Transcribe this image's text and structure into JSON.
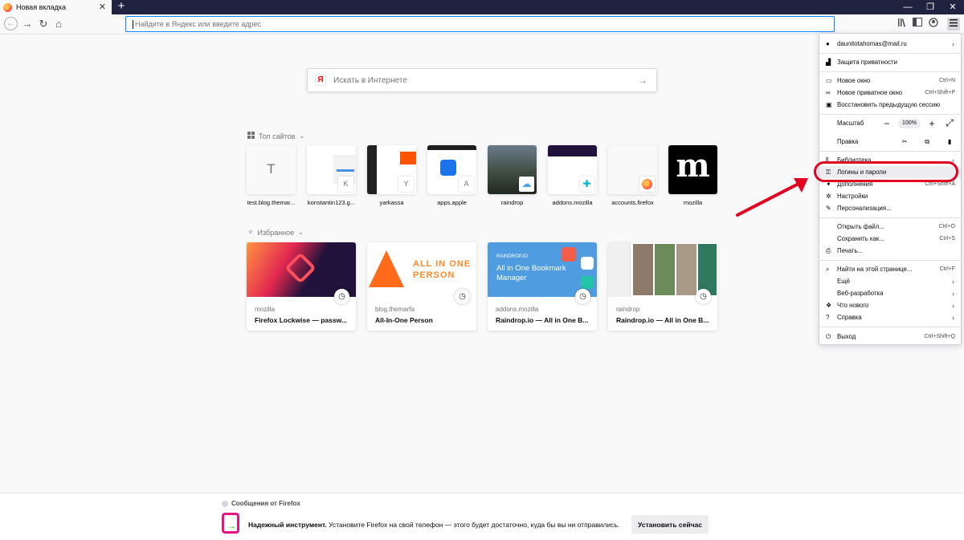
{
  "tab": {
    "title": "Новая вкладка",
    "close": "✕"
  },
  "window": {
    "minimize": "—",
    "restore": "❐",
    "close": "✕",
    "newtab": "+"
  },
  "nav": {
    "back": "←",
    "forward": "→",
    "reload": "↻",
    "home": "⌂",
    "url_placeholder": "Найдите в Яндекс или введите адрес",
    "url_value": ""
  },
  "search": {
    "logo": "Я",
    "placeholder": "Искать в Интернете",
    "go": "→"
  },
  "topsites": {
    "heading": "Топ сайтов",
    "items": [
      {
        "label": "test.blog.themar...",
        "letter": "T"
      },
      {
        "label": "konstantin123.g...",
        "letter": "K"
      },
      {
        "label": "yarkassa",
        "letter": "Y"
      },
      {
        "label": "apps.apple",
        "letter": "A"
      },
      {
        "label": "raindrop",
        "letter": ""
      },
      {
        "label": "addons.mozilla",
        "letter": ""
      },
      {
        "label": "accounts.firefox",
        "letter": ""
      },
      {
        "label": "mozilla",
        "letter": "m"
      }
    ]
  },
  "highlights": {
    "heading": "Избранное",
    "items": [
      {
        "host": "mozilla",
        "title": "Firefox Lockwise — passw..."
      },
      {
        "host": "blog.themarfa",
        "title": "All-In-One Person",
        "thumb_text": "ALL IN ONE PERSON"
      },
      {
        "host": "addons.mozilla",
        "title": "Raindrop.io — All in One B...",
        "thumb_text": "All in One Bookmark Manager",
        "thumb_brand": "RAINDROP.IO"
      },
      {
        "host": "raindrop",
        "title": "Raindrop.io — All in One B..."
      }
    ]
  },
  "menu": {
    "account": "daunitotahomas@mail.ru",
    "privacy": "Защита приватности",
    "new_window": {
      "label": "Новое окно",
      "shortcut": "Ctrl+N"
    },
    "private_window": {
      "label": "Новое приватное окно",
      "shortcut": "Ctrl+Shift+P"
    },
    "restore_session": "Восстановить предыдущую сессию",
    "zoom": {
      "label": "Масштаб",
      "minus": "−",
      "value": "100%",
      "plus": "+",
      "fullscreen": "⤢"
    },
    "edit": "Правка",
    "library": "Библиотека",
    "logins": "Логины и пароли",
    "addons": {
      "label": "Дополнения",
      "shortcut": "Ctrl+Shift+A"
    },
    "settings": "Настройки",
    "customize": "Персонализация...",
    "open_file": {
      "label": "Открыть файл...",
      "shortcut": "Ctrl+O"
    },
    "save_as": {
      "label": "Сохранить как...",
      "shortcut": "Ctrl+S"
    },
    "print": "Печать...",
    "find": {
      "label": "Найти на этой странице...",
      "shortcut": "Ctrl+F"
    },
    "more": "Ещё",
    "webdev": "Веб-разработка",
    "whats_new": "Что нового",
    "help": "Справка",
    "exit": {
      "label": "Выход",
      "shortcut": "Ctrl+Shift+Q"
    }
  },
  "footer": {
    "heading": "Сообщения от Firefox",
    "bold": "Надежный инструмент.",
    "text": " Установите Firefox на свой телефон — этого будет достаточно, куда бы вы ни отправились.",
    "button": "Установить сейчас"
  },
  "colors": {
    "accent": "#0a84ff",
    "annotation": "#e1001f",
    "tabbar": "#202340"
  }
}
